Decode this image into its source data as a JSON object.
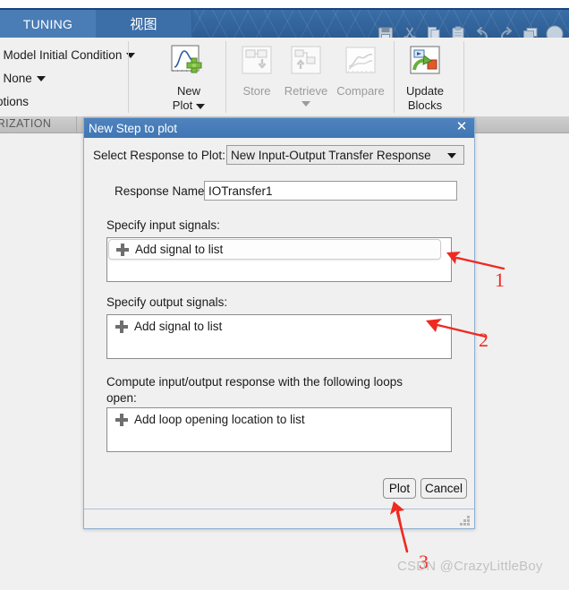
{
  "ribbon": {
    "tabs": [
      {
        "id": "tuning",
        "label": "TUNING",
        "active": true
      },
      {
        "id": "view",
        "label": "视图",
        "active": false
      }
    ],
    "quick_access": [
      "save-icon",
      "cut-icon",
      "copy-icon",
      "paste-icon",
      "undo-icon",
      "redo-icon",
      "windows-icon",
      "help-icon"
    ],
    "left_panel": {
      "row1_label": ": Model Initial Condition",
      "row2_label": ": None",
      "row3_label": "otions"
    },
    "buttons": [
      {
        "id": "new-plot",
        "label": "New",
        "label2": "Plot",
        "icon": "new-plot-icon",
        "has_caret": true,
        "enabled": true
      },
      {
        "id": "store",
        "label": "Store",
        "icon": "store-icon",
        "has_caret": false,
        "enabled": false
      },
      {
        "id": "retrieve",
        "label": "Retrieve",
        "icon": "retrieve-icon",
        "has_caret": true,
        "enabled": false
      },
      {
        "id": "compare",
        "label": "Compare",
        "icon": "compare-icon",
        "has_caret": false,
        "enabled": false
      },
      {
        "id": "update-blocks",
        "label": "Update",
        "label2": "Blocks",
        "icon": "update-blocks-icon",
        "has_caret": false,
        "enabled": true
      }
    ],
    "section_label": "ARIZATION"
  },
  "dialog": {
    "title": "New Step to plot",
    "close_label": "✕",
    "select_response_label": "Select Response to Plot:",
    "select_response_value": "New Input-Output Transfer Response",
    "response_name_label": "Response Name:",
    "response_name_value": "IOTransfer1",
    "input_signals_label": "Specify input signals:",
    "input_signals_add": "Add signal to list",
    "output_signals_label": "Specify output signals:",
    "output_signals_add": "Add signal to list",
    "loops_label_line1": "Compute input/output response with the following loops",
    "loops_label_line2": "open:",
    "loops_add": "Add loop opening location to list",
    "plot_button": "Plot",
    "cancel_button": "Cancel"
  },
  "annotations": {
    "markers": [
      {
        "id": "1",
        "label": "1"
      },
      {
        "id": "2",
        "label": "2"
      },
      {
        "id": "3",
        "label": "3"
      }
    ],
    "color": "#ee2a21"
  },
  "watermark": "CSDN @CrazyLittleBoy",
  "colors": {
    "tab_active": "#4a7cb5",
    "tab_bar": "#2f6096",
    "dialog_title": "#4f83bd",
    "window_bg": "#f0f0f0",
    "annotation_red": "#ee2a21",
    "top_rule": "#17457e"
  }
}
